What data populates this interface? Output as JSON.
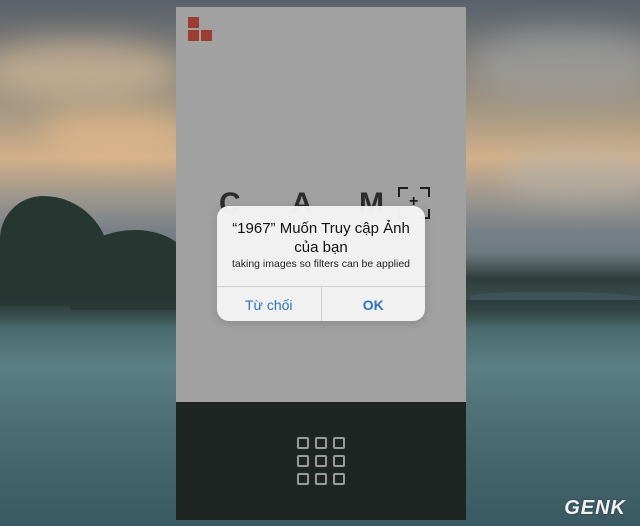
{
  "app": {
    "word_letters": [
      "C",
      "A",
      "M"
    ],
    "logo_icon": "app-logo-blocks",
    "accent_color": "#9b3d33",
    "bottom_icon": "grid-gallery-icon"
  },
  "alert": {
    "title": "“1967” Muốn Truy cập Ảnh của bạn",
    "message": "taking images so filters can be applied",
    "deny_label": "Từ chối",
    "ok_label": "OK",
    "button_color": "#2f74c0"
  },
  "watermark": "GENK"
}
